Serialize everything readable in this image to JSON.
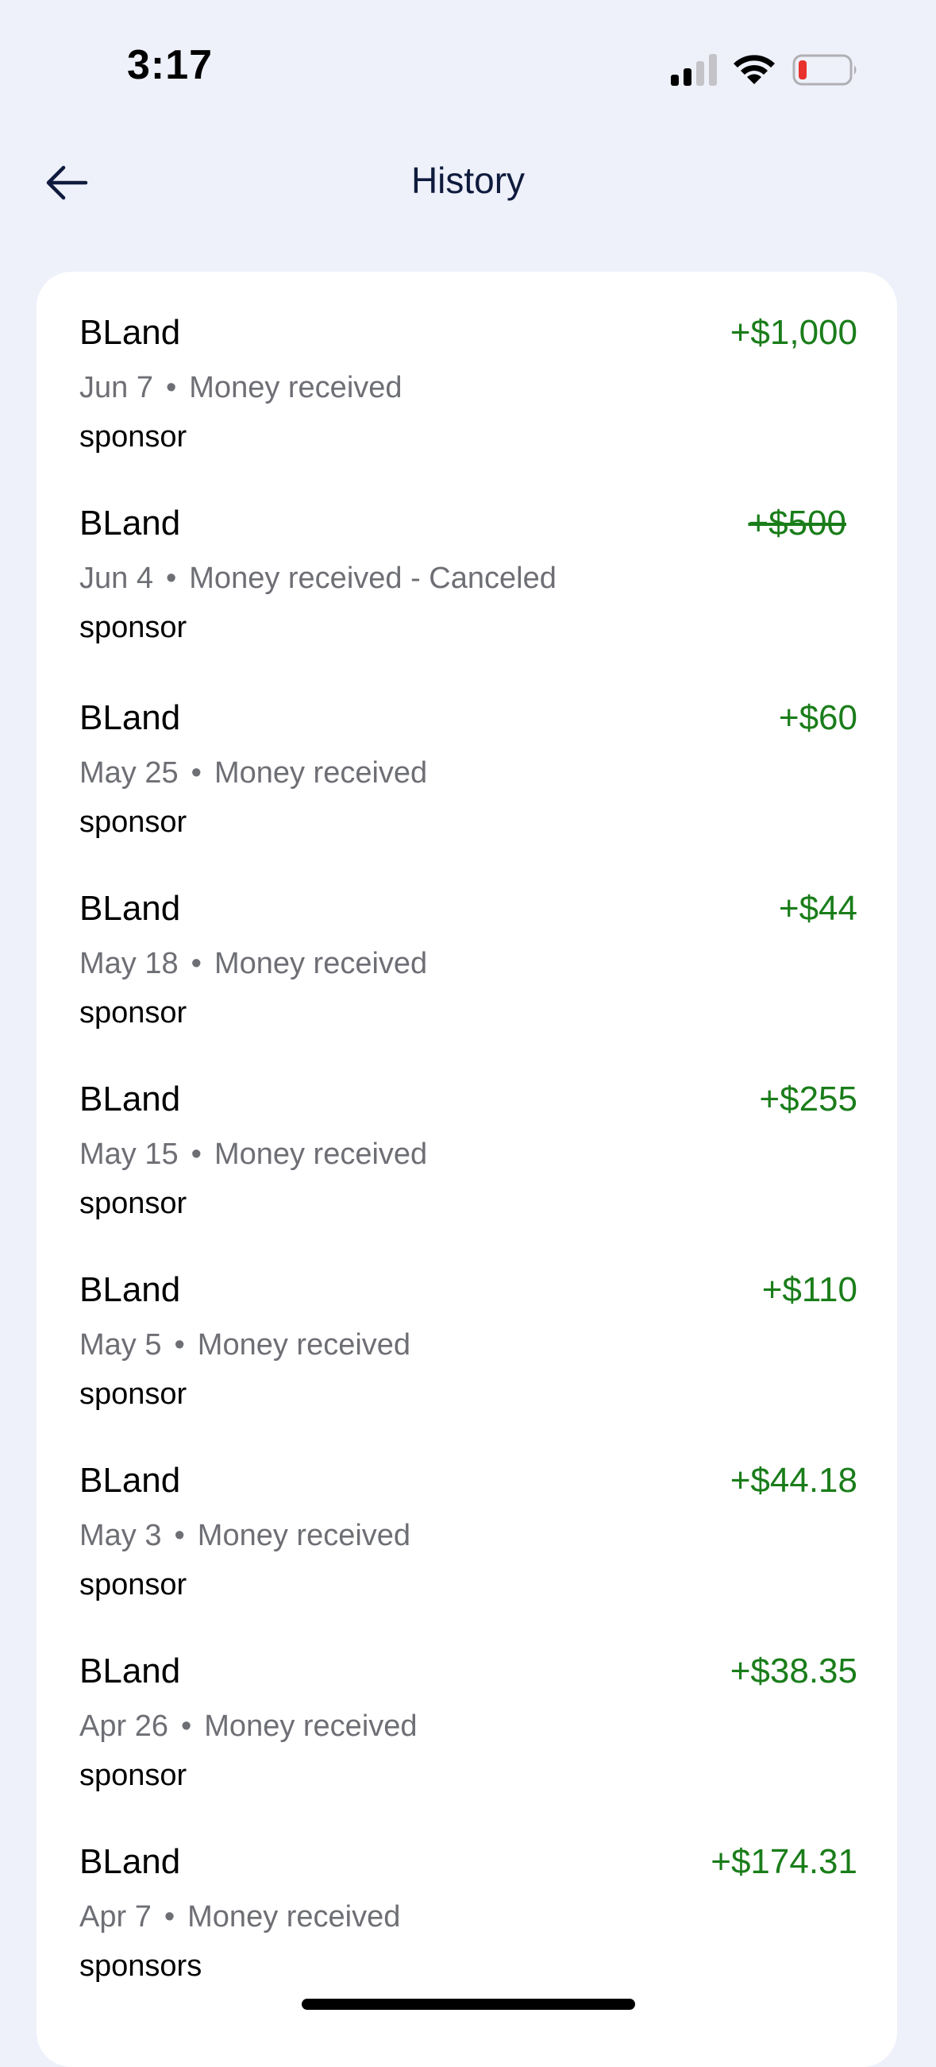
{
  "status_bar": {
    "time": "3:17",
    "icons": [
      "cellular-signal-icon",
      "wifi-icon",
      "battery-low-icon"
    ]
  },
  "header": {
    "title": "History",
    "back_icon": "arrow-left-icon"
  },
  "colors": {
    "background": "#eef0fa",
    "card": "#ffffff",
    "amount_positive": "#1a7d1a",
    "meta_text": "#6e6f75",
    "title_text": "#0f1b3d",
    "battery_low": "#e8322b"
  },
  "transactions": [
    {
      "name": "BLand",
      "amount": "+$1,000",
      "date": "Jun 7",
      "status": "Money received",
      "note": "sponsor",
      "canceled": false
    },
    {
      "name": "BLand",
      "amount": "+$500",
      "date": "Jun 4",
      "status": "Money received - Canceled",
      "note": "sponsor",
      "canceled": true
    },
    {
      "name": "BLand",
      "amount": "+$60",
      "date": "May 25",
      "status": "Money received",
      "note": "sponsor",
      "canceled": false
    },
    {
      "name": "BLand",
      "amount": "+$44",
      "date": "May 18",
      "status": "Money received",
      "note": "sponsor",
      "canceled": false
    },
    {
      "name": "BLand",
      "amount": "+$255",
      "date": "May 15",
      "status": "Money received",
      "note": "sponsor",
      "canceled": false
    },
    {
      "name": "BLand",
      "amount": "+$110",
      "date": "May 5",
      "status": "Money received",
      "note": "sponsor",
      "canceled": false
    },
    {
      "name": "BLand",
      "amount": "+$44.18",
      "date": "May 3",
      "status": "Money received",
      "note": "sponsor",
      "canceled": false
    },
    {
      "name": "BLand",
      "amount": "+$38.35",
      "date": "Apr 26",
      "status": "Money received",
      "note": "sponsor",
      "canceled": false
    },
    {
      "name": "BLand",
      "amount": "+$174.31",
      "date": "Apr 7",
      "status": "Money received",
      "note": "sponsors",
      "canceled": false
    }
  ],
  "separator": "•"
}
